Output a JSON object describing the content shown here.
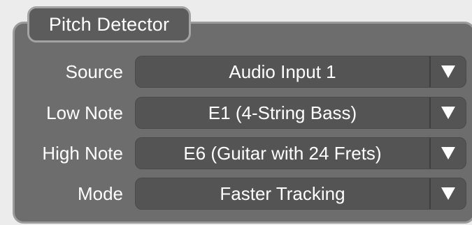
{
  "panel": {
    "title": "Pitch Detector"
  },
  "fields": [
    {
      "label": "Source",
      "value": "Audio Input 1",
      "icon": "dropdown-arrow-icon"
    },
    {
      "label": "Low Note",
      "value": "E1 (4-String Bass)",
      "icon": "dropdown-arrow-icon"
    },
    {
      "label": "High Note",
      "value": "E6 (Guitar with 24 Frets)",
      "icon": "dropdown-arrow-icon"
    },
    {
      "label": "Mode",
      "value": "Faster Tracking",
      "icon": "dropdown-arrow-icon"
    }
  ]
}
